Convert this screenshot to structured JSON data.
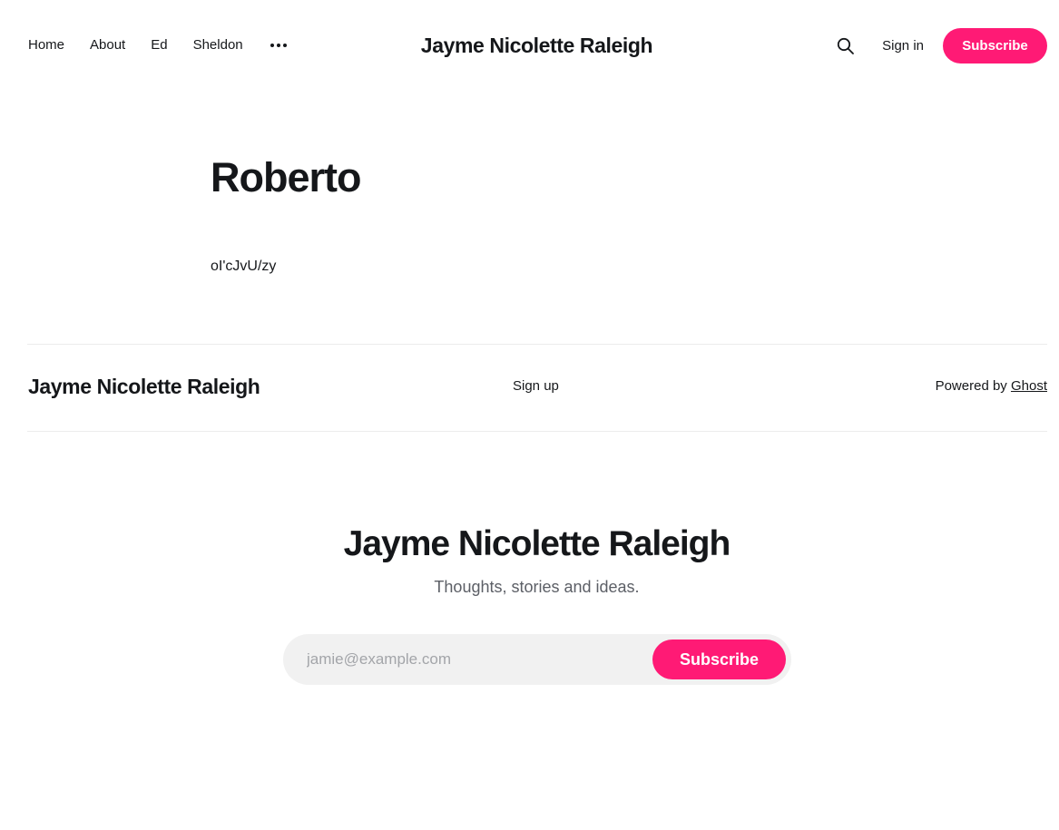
{
  "header": {
    "nav": [
      {
        "label": "Home"
      },
      {
        "label": "About"
      },
      {
        "label": "Ed"
      },
      {
        "label": "Sheldon"
      }
    ],
    "more_icon": "more-dots-icon",
    "site_title": "Jayme Nicolette Raleigh",
    "search_icon": "search-icon",
    "signin_label": "Sign in",
    "subscribe_label": "Subscribe"
  },
  "article": {
    "title": "Roberto",
    "body": "oI'cJvU/zy"
  },
  "footer": {
    "site_title": "Jayme Nicolette Raleigh",
    "signup_label": "Sign up",
    "powered_prefix": "Powered by",
    "powered_link": "Ghost"
  },
  "cta": {
    "title": "Jayme Nicolette Raleigh",
    "subtitle": "Thoughts, stories and ideas.",
    "email_placeholder": "jamie@example.com",
    "button_label": "Subscribe"
  },
  "colors": {
    "accent": "#ff1a75",
    "text": "#15171a",
    "muted": "#5c5f66",
    "input_bg": "#f1f1f1"
  }
}
